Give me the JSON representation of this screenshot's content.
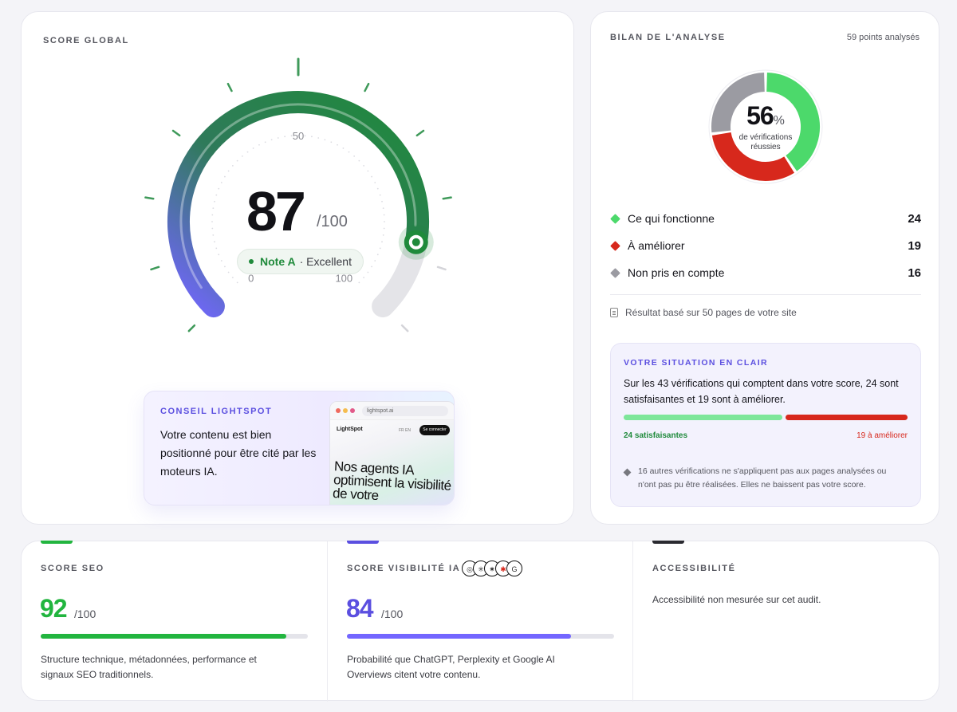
{
  "score_global": {
    "title": "SCORE GLOBAL",
    "value": 87,
    "value_text": "87",
    "max_text": "/100",
    "tick_min": "0",
    "tick_mid": "50",
    "tick_max": "100",
    "grade_label": "Note A",
    "grade_desc": "· Excellent",
    "colors": {
      "start": "#7366ff",
      "end": "#1f8a3b",
      "track": "#e4e4e8"
    }
  },
  "tip": {
    "title": "CONSEIL LIGHTSPOT",
    "text": "Votre contenu est bien positionné pour être cité par les moteurs IA.",
    "mock": {
      "url": "lightspot.ai",
      "brand": "LightSpot",
      "lang": "FR  EN",
      "cta": "Se connecter",
      "headline": "Nos agents IA optimisent la visibilité de votre"
    }
  },
  "summary": {
    "title": "BILAN DE L'ANALYSE",
    "points": "59 points analysés",
    "percent": "56",
    "percent_sign": "%",
    "caption_1": "de vérifications",
    "caption_2": "réussies",
    "legend": [
      {
        "label": "Ce qui fonctionne",
        "value": "24",
        "color": "#4cd96b"
      },
      {
        "label": "À améliorer",
        "value": "19",
        "color": "#d7281c"
      },
      {
        "label": "Non pris en compte",
        "value": "16",
        "color": "#9b9ba2"
      }
    ],
    "based_on": "Résultat basé sur 50 pages de votre site"
  },
  "situation": {
    "title": "VOTRE SITUATION EN CLAIR",
    "text": "Sur les 43 vérifications qui comptent dans votre score, 24 sont satisfaisantes et 19 sont à améliorer.",
    "ok_label": "24 satisfaisantes",
    "ko_label": "19 à améliorer",
    "note": "16 autres vérifications ne s'appliquent pas aux pages analysées ou n'ont pas pu être réalisées. Elles ne baissent pas votre score."
  },
  "metrics": [
    {
      "title": "SCORE SEO",
      "value": "92",
      "max": "/100",
      "fill_pct": 92,
      "color": "#22b53f",
      "desc": "Structure technique, métadonnées, performance et signaux SEO traditionnels."
    },
    {
      "title": "SCORE VISIBILITÉ IA",
      "value": "84",
      "max": "/100",
      "fill_pct": 84,
      "color": "#5b4fe0",
      "bar_color": "#7366ff",
      "desc": "Probabilité que ChatGPT, Perplexity et Google AI Overviews citent votre contenu."
    },
    {
      "title": "ACCESSIBILITÉ",
      "desc": "Accessibilité non mesurée sur cet audit."
    }
  ]
}
